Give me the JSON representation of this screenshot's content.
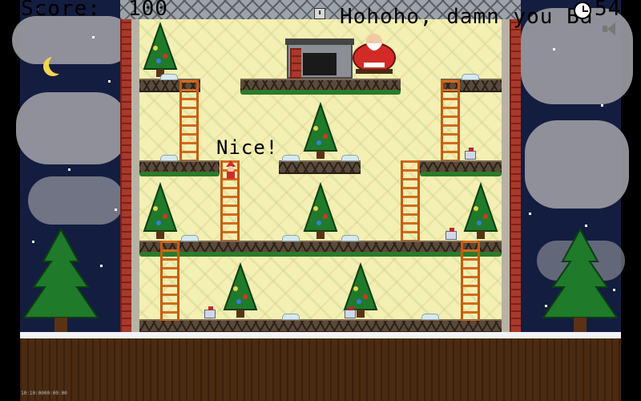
{
  "hud": {
    "score_label": "Score:",
    "score_value": "100",
    "message": "Hohoho, damn you Ba",
    "timer": "54",
    "clock_icon": "clock-icon",
    "speaker_icon": "speaker-icon",
    "down_arrow_icon": "down-arrow-icon"
  },
  "popup": {
    "text": "Nice!"
  },
  "corner_text": "10:10:0000:00:00",
  "colors": {
    "sky": "#131d3f",
    "tower_wall": "#f4efb2",
    "brick": "#a8392b",
    "girder": "#5b4a3a",
    "ladder": "#d26b1d",
    "tree": "#1f7a2a",
    "ground": "#4a2b12"
  }
}
